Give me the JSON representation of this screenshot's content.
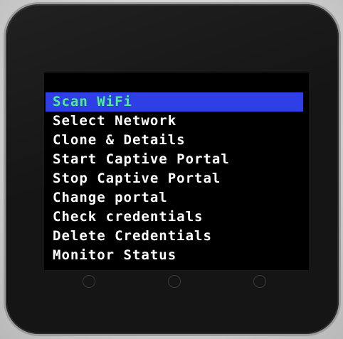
{
  "menu": {
    "items": [
      {
        "label": "Scan WiFi",
        "selected": true
      },
      {
        "label": "Select Network",
        "selected": false
      },
      {
        "label": "Clone & Details",
        "selected": false
      },
      {
        "label": "Start Captive Portal",
        "selected": false
      },
      {
        "label": "Stop Captive Portal",
        "selected": false
      },
      {
        "label": "Change portal",
        "selected": false
      },
      {
        "label": "Check credentials",
        "selected": false
      },
      {
        "label": "Delete Credentials",
        "selected": false
      },
      {
        "label": "Monitor Status",
        "selected": false
      }
    ]
  },
  "colors": {
    "highlight_background": "#2f3fe6",
    "highlight_text": "#4ef08a",
    "text": "#ffffff",
    "screen_background": "#000000"
  }
}
